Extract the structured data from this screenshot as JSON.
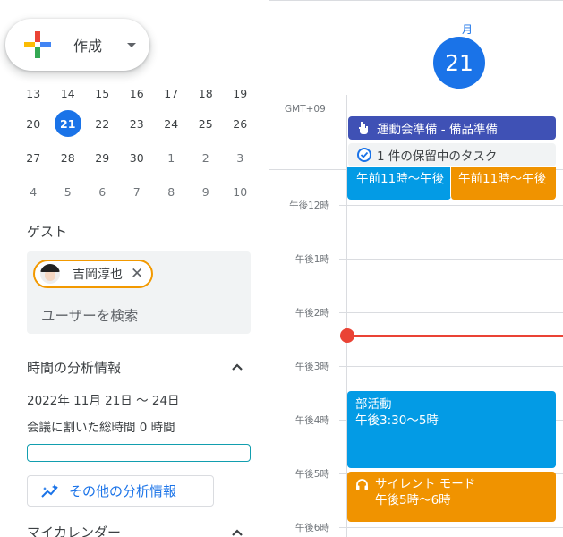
{
  "create": {
    "label": "作成"
  },
  "mini_calendar": {
    "rows": [
      [
        {
          "d": "13"
        },
        {
          "d": "14"
        },
        {
          "d": "15"
        },
        {
          "d": "16"
        },
        {
          "d": "17"
        },
        {
          "d": "18"
        },
        {
          "d": "19"
        }
      ],
      [
        {
          "d": "20"
        },
        {
          "d": "21",
          "selected": true
        },
        {
          "d": "22"
        },
        {
          "d": "23"
        },
        {
          "d": "24"
        },
        {
          "d": "25"
        },
        {
          "d": "26"
        }
      ],
      [
        {
          "d": "27"
        },
        {
          "d": "28"
        },
        {
          "d": "29"
        },
        {
          "d": "30"
        },
        {
          "d": "1",
          "out": true
        },
        {
          "d": "2",
          "out": true
        },
        {
          "d": "3",
          "out": true
        }
      ],
      [
        {
          "d": "4",
          "out": true
        },
        {
          "d": "5",
          "out": true
        },
        {
          "d": "6",
          "out": true
        },
        {
          "d": "7",
          "out": true
        },
        {
          "d": "8",
          "out": true
        },
        {
          "d": "9",
          "out": true
        },
        {
          "d": "10",
          "out": true
        }
      ]
    ]
  },
  "guests": {
    "title": "ゲスト",
    "chip_name": "吉岡淳也",
    "chip_close": "✕",
    "search_placeholder": "ユーザーを検索"
  },
  "analytics": {
    "title": "時間の分析情報",
    "range": "2022年 11月 21日 〜 24日",
    "total": "会議に割いた総時間 0 時間",
    "more_label": "その他の分析情報"
  },
  "my_calendars": {
    "title": "マイカレンダー"
  },
  "day_view": {
    "dow": "月",
    "date": "21",
    "timezone": "GMT+09",
    "allday_events": [
      {
        "label": "運動会準備 - 備品準備",
        "color": "#3f51b5"
      }
    ],
    "task": {
      "label": "1 件の保留中のタスク"
    },
    "hours": [
      "午後12時",
      "午後1時",
      "午後2時",
      "午後3時",
      "午後4時",
      "午後5時",
      "午後6時"
    ],
    "events": {
      "ev1": {
        "time": "午前11時〜午後",
        "color": "#039be5"
      },
      "ev2": {
        "time": "午前11時〜午後",
        "color": "#f09300"
      },
      "bukatsu": {
        "title": "部活動",
        "time": "午後3:30〜5時",
        "color": "#039be5"
      },
      "silent": {
        "title": "サイレント モード",
        "time": "午後5時〜6時",
        "color": "#f09300"
      }
    }
  }
}
